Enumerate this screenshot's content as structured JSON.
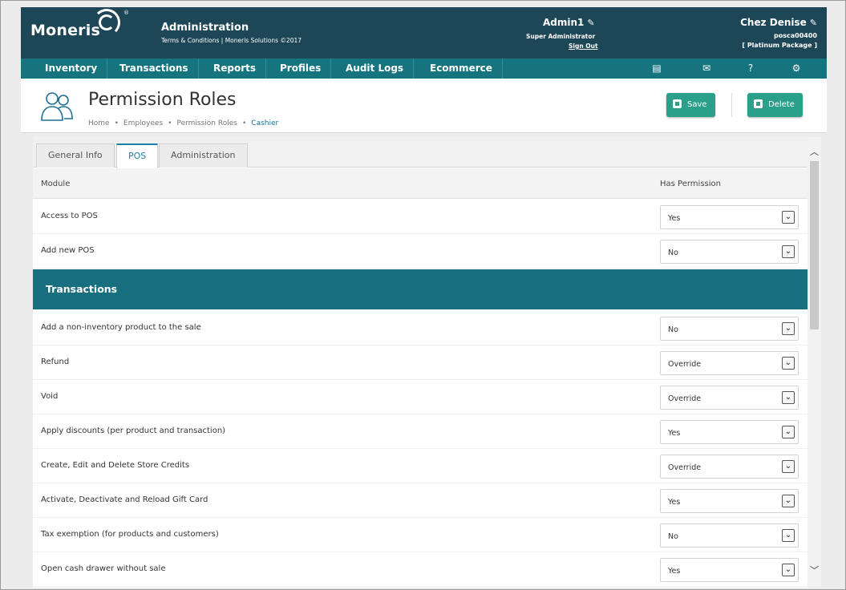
{
  "header": {
    "logo": "Moneris",
    "section_title": "Administration",
    "section_sub": "Terms & Conditions | Moneris Solutions ©2017",
    "user_name": "Admin1",
    "user_role": "Super Administrator",
    "sign_out": "Sign Out",
    "store_name": "Chez Denise",
    "store_id": "posca00400",
    "store_package": "[ Platinum Package ]"
  },
  "nav": {
    "items": [
      "Inventory",
      "Transactions",
      "Reports",
      "Profiles",
      "Audit Logs",
      "Ecommerce"
    ],
    "icons": [
      "printer-icon",
      "mail-icon",
      "help-icon",
      "settings-icon"
    ]
  },
  "page": {
    "title": "Permission Roles",
    "breadcrumb": [
      "Home",
      "Employees",
      "Permission Roles",
      "Cashier"
    ],
    "save_label": "Save",
    "delete_label": "Delete"
  },
  "tabs": [
    "General Info",
    "POS",
    "Administration"
  ],
  "active_tab": "POS",
  "table": {
    "col_module": "Module",
    "col_permission": "Has Permission",
    "pos_rows": [
      {
        "label": "Access to POS",
        "value": "Yes"
      },
      {
        "label": "Add new POS",
        "value": "No"
      }
    ],
    "section_title": "Transactions",
    "transaction_rows": [
      {
        "label": "Add a non-inventory product to the sale",
        "value": "No"
      },
      {
        "label": "Refund",
        "value": "Override"
      },
      {
        "label": "Void",
        "value": "Override"
      },
      {
        "label": "Apply discounts (per product and transaction)",
        "value": "Yes"
      },
      {
        "label": "Create, Edit and Delete Store Credits",
        "value": "Override"
      },
      {
        "label": "Activate, Deactivate and Reload Gift Card",
        "value": "Yes"
      },
      {
        "label": "Tax exemption (for products and customers)",
        "value": "No"
      },
      {
        "label": "Open cash drawer without sale",
        "value": "Yes"
      }
    ]
  },
  "colors": {
    "header_bg": "#1d4657",
    "nav_bg": "#16747f",
    "section_bg": "#176f7f",
    "button_bg": "#2aa08a"
  }
}
